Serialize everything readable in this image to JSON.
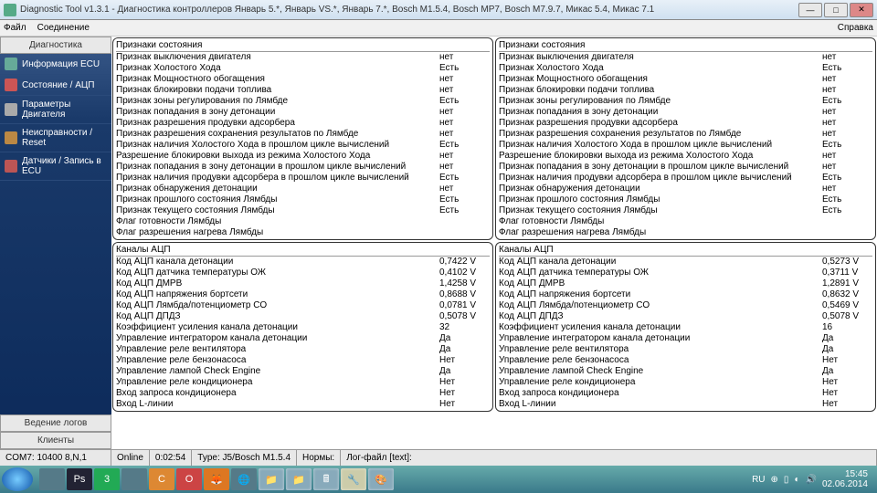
{
  "window": {
    "title": "Diagnostic Tool v1.3.1 - Диагностика контроллеров Январь 5.*, Январь VS.*, Январь 7.*, Bosch M1.5.4, Bosch MP7, Bosch M7.9.7, Микас 5.4, Микас 7.1"
  },
  "menu": {
    "file": "Файл",
    "conn": "Соединение",
    "help": "Справка"
  },
  "sidebar": {
    "head": "Диагностика",
    "items": [
      "Информация ECU",
      "Состояние / АЦП",
      "Параметры Двигателя",
      "Неисправности / Reset",
      "Датчики / Запись в ECU"
    ],
    "log": "Ведение логов",
    "clients": "Клиенты"
  },
  "headers": {
    "state": "Признаки состояния",
    "adc": "Каналы АЦП"
  },
  "state_labels": [
    "Признак выключения двигателя",
    "Признак Холостого Хода",
    "Признак Мощностного обогащения",
    "Признак блокировки подачи топлива",
    "Признак зоны регулирования по Лямбде",
    "Признак попадания в зону детонации",
    "Признак разрешения продувки адсорбера",
    "Признак разрешения сохранения результатов по Лямбде",
    "Признак наличия Холостого Хода в прошлом цикле вычислений",
    "Разрешение блокировки выхода из режима Холостого Хода",
    "Признак попадания в зону детонации в прошлом цикле вычислений",
    "Признак наличия продувки адсорбера в прошлом цикле вычислений",
    "Признак обнаружения детонации",
    "Признак прошлого состояния Лямбды",
    "Признак текущего состояния Лямбды",
    "Флаг готовности Лямбды",
    "Флаг разрешения нагрева Лямбды"
  ],
  "state_left": [
    "нет",
    "Есть",
    "нет",
    "нет",
    "Есть",
    "нет",
    "нет",
    "нет",
    "Есть",
    "нет",
    "нет",
    "Есть",
    "нет",
    "Есть",
    "Есть",
    "",
    ""
  ],
  "state_right": [
    "нет",
    "Есть",
    "нет",
    "нет",
    "Есть",
    "нет",
    "нет",
    "нет",
    "Есть",
    "нет",
    "нет",
    "Есть",
    "нет",
    "Есть",
    "Есть",
    "",
    ""
  ],
  "adc_labels": [
    "Код АЦП канала детонации",
    "Код АЦП датчика температуры ОЖ",
    "Код АЦП ДМРВ",
    "Код АЦП напряжения бортсети",
    "Код АЦП Лямбда/потенциометр CO",
    "Код АЦП ДПДЗ",
    "Коэффициент усиления канала детонации",
    "",
    "Управление интегратором канала детонации",
    "Управление реле вентилятора",
    "Управление реле бензонасоса",
    "Управление лампой Check Engine",
    "Управление реле кондиционера",
    "Вход запроса кондиционера",
    "Вход L-линии"
  ],
  "adc_left": [
    "0,7422 V",
    "0,4102 V",
    "1,4258 V",
    "0,8688 V",
    "0,0781 V",
    "0,5078 V",
    "32",
    "",
    "Да",
    "Да",
    "Нет",
    "Да",
    "Нет",
    "Нет",
    "Нет"
  ],
  "adc_right": [
    "0,5273 V",
    "0,3711 V",
    "1,2891 V",
    "0,8632 V",
    "0,5469 V",
    "0,5078 V",
    "16",
    "",
    "Да",
    "Да",
    "Нет",
    "Да",
    "Нет",
    "Нет",
    "Нет"
  ],
  "status": {
    "com": "COM7: 10400 8,N,1",
    "online": "Online",
    "time": "0:02:54",
    "type_lbl": "Type:",
    "type": "J5/Bosch M1.5.4",
    "norm": "Нормы:",
    "log": "Лог-файл [text]:"
  },
  "tray": {
    "lang": "RU",
    "time": "15:45",
    "date": "02.06.2014"
  }
}
